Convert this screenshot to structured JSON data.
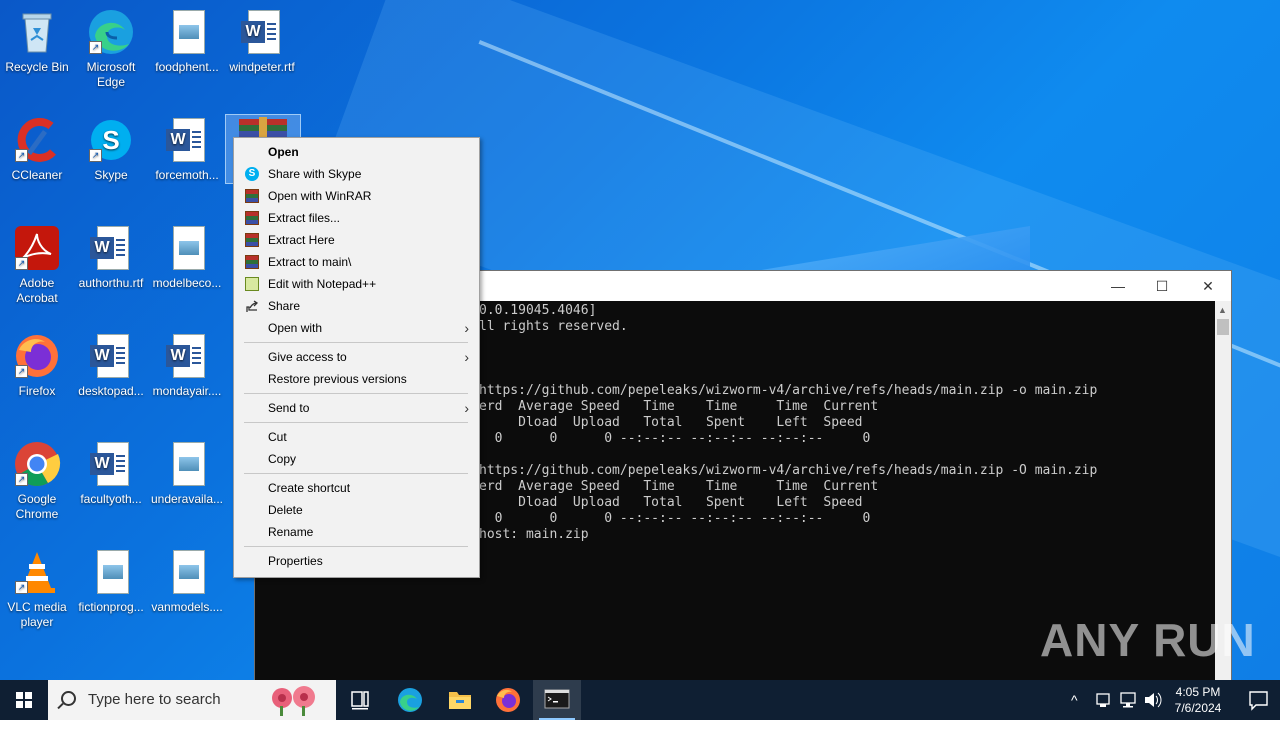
{
  "desktop": {
    "icons": [
      {
        "id": "recycle",
        "label": "Recycle Bin",
        "icon": "recycle-bin-icon"
      },
      {
        "id": "edge",
        "label": "Microsoft Edge",
        "icon": "edge-icon"
      },
      {
        "id": "foodphent",
        "label": "foodphent...",
        "icon": "image-file-icon"
      },
      {
        "id": "windpeter",
        "label": "windpeter.rtf",
        "icon": "word-file-icon"
      },
      {
        "id": "ccleaner",
        "label": "CCleaner",
        "icon": "ccleaner-icon"
      },
      {
        "id": "skype",
        "label": "Skype",
        "icon": "skype-icon"
      },
      {
        "id": "forcemoth",
        "label": "forcemoth...",
        "icon": "word-file-icon"
      },
      {
        "id": "acrobat",
        "label": "Adobe Acrobat",
        "icon": "acrobat-icon"
      },
      {
        "id": "authorthu",
        "label": "authorthu.rtf",
        "icon": "word-file-icon"
      },
      {
        "id": "modelbeco",
        "label": "modelbeco...",
        "icon": "image-file-icon"
      },
      {
        "id": "firefox",
        "label": "Firefox",
        "icon": "firefox-icon"
      },
      {
        "id": "desktopad",
        "label": "desktopad...",
        "icon": "word-file-icon"
      },
      {
        "id": "mondayair",
        "label": "mondayair....",
        "icon": "word-file-icon"
      },
      {
        "id": "chrome",
        "label": "Google Chrome",
        "icon": "chrome-icon"
      },
      {
        "id": "facultyoth",
        "label": "facultyoth...",
        "icon": "word-file-icon"
      },
      {
        "id": "underavaila",
        "label": "underavaila...",
        "icon": "image-file-icon"
      },
      {
        "id": "vlc",
        "label": "VLC media player",
        "icon": "vlc-icon"
      },
      {
        "id": "fictionprog",
        "label": "fictionprog...",
        "icon": "image-file-icon"
      },
      {
        "id": "vanmodels",
        "label": "vanmodels....",
        "icon": "image-file-icon"
      }
    ]
  },
  "console": {
    "controls": {
      "minimize": "—",
      "maximize": "☐",
      "close": "✕"
    },
    "lines": [
      "0.0.19045.4046]",
      "ll rights reserved.",
      "",
      "",
      "https://github.com/pepeleaks/wizworm-v4/archive/refs/heads/main.zip -o main.zip",
      "erd  Average Speed   Time    Time     Time  Current",
      "     Dload  Upload   Total   Spent    Left  Speed",
      "  0      0      0 --:--:-- --:--:-- --:--:--     0",
      "",
      "https://github.com/pepeleaks/wizworm-v4/archive/refs/heads/main.zip -O main.zip",
      "erd  Average Speed   Time    Time     Time  Current",
      "     Dload  Upload   Total   Spent    Left  Speed",
      "  0      0      0 --:--:-- --:--:-- --:--:--     0",
      "host: main.zip"
    ]
  },
  "watermark": "ANY RUN",
  "context_menu": {
    "items": [
      {
        "label": "Open",
        "bold": true,
        "icon": ""
      },
      {
        "label": "Share with Skype",
        "icon": "skype-icon"
      },
      {
        "label": "Open with WinRAR",
        "icon": "winrar-icon"
      },
      {
        "label": "Extract files...",
        "icon": "winrar-icon"
      },
      {
        "label": "Extract Here",
        "icon": "winrar-icon"
      },
      {
        "label": "Extract to main\\",
        "icon": "winrar-icon"
      },
      {
        "label": "Edit with Notepad++",
        "icon": "notepadpp-icon"
      },
      {
        "label": "Share",
        "icon": "share-icon"
      },
      {
        "label": "Open with",
        "submenu": true
      },
      {
        "label": "Give access to",
        "submenu": true
      },
      {
        "label": "Restore previous versions"
      },
      {
        "label": "Send to",
        "submenu": true
      },
      {
        "label": "Cut"
      },
      {
        "label": "Copy"
      },
      {
        "label": "Create shortcut"
      },
      {
        "label": "Delete"
      },
      {
        "label": "Rename"
      },
      {
        "label": "Properties"
      }
    ],
    "submenu_arrow": "›"
  },
  "taskbar": {
    "search_placeholder": "Type here to search",
    "apps": [
      "task-view-icon",
      "edge-icon",
      "file-explorer-icon",
      "firefox-icon",
      "cmd-icon"
    ],
    "tray": {
      "chevron": "^"
    },
    "clock": {
      "time": "4:05 PM",
      "date": "7/6/2024"
    }
  }
}
